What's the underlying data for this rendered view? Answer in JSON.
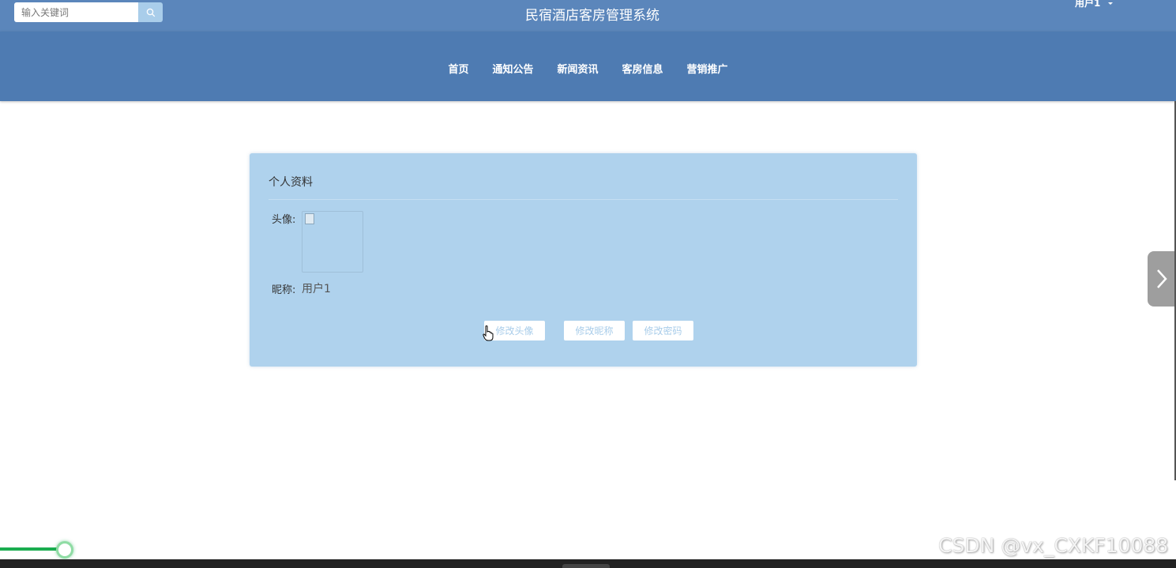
{
  "header": {
    "search_placeholder": "输入关键词",
    "site_title": "民宿酒店客房管理系统",
    "user_name": "用户1"
  },
  "nav": {
    "items": [
      "首页",
      "通知公告",
      "新闻资讯",
      "客房信息",
      "营销推广"
    ]
  },
  "profile": {
    "title": "个人资料",
    "avatar_label": "头像:",
    "nickname_label": "昵称:",
    "nickname_value": "用户1",
    "btn_change_avatar": "修改头像",
    "btn_change_nickname": "修改昵称",
    "btn_change_password": "修改密码"
  },
  "watermark": "CSDN @vx_CXKF10088",
  "colors": {
    "topbar": "#5b86bb",
    "navbar": "#4e7bb2",
    "card": "#afd2ed",
    "button_text": "#a9cdea",
    "progress": "#1aad4f"
  }
}
